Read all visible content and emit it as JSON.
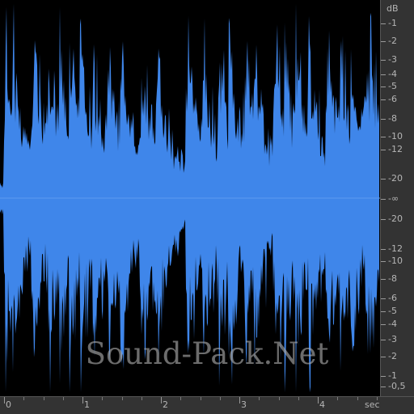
{
  "editor": {
    "db_scale": {
      "unit": "dB",
      "labels": [
        "-1",
        "-2",
        "-3",
        "-4",
        "-5",
        "-6",
        "-8",
        "-10",
        "-12",
        "-20",
        "-∞",
        "-20",
        "-12",
        "-10",
        "-8",
        "-6",
        "-5",
        "-4",
        "-3",
        "-2",
        "-1",
        "-0,5"
      ]
    },
    "time_scale": {
      "unit": "sec",
      "labels": [
        "0",
        "1",
        "2",
        "3",
        "4"
      ]
    },
    "waveform": {
      "color": "#3f86ea",
      "background": "#000000",
      "duration_sec": 4.7,
      "transients_sec": [
        0.02,
        0.11,
        0.37,
        0.56,
        0.71,
        0.83,
        0.96,
        1.13,
        1.32,
        1.48,
        1.75,
        1.93,
        2.33,
        2.53,
        2.74,
        2.86,
        3.07,
        3.18,
        3.45,
        3.57,
        3.72,
        3.88,
        4.12,
        4.28,
        4.42,
        4.6,
        4.67
      ]
    },
    "watermark": "Sound-Pack.Net"
  },
  "colors": {
    "panel_bg": "#000000",
    "ruler_bg": "#333333",
    "ruler_text": "#b5b5b5",
    "waveform": "#3f86ea"
  }
}
